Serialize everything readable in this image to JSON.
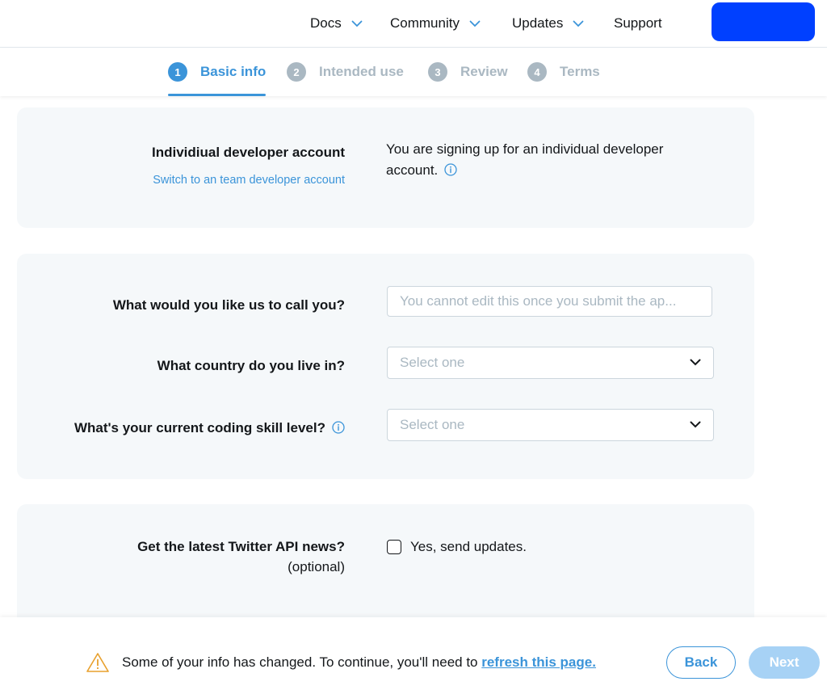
{
  "nav": {
    "items": [
      {
        "label": "Docs",
        "has_dropdown": true
      },
      {
        "label": "Community",
        "has_dropdown": true
      },
      {
        "label": "Updates",
        "has_dropdown": true
      },
      {
        "label": "Support",
        "has_dropdown": false
      }
    ],
    "cta_label": ""
  },
  "stepper": {
    "steps": [
      {
        "number": "1",
        "label": "Basic info",
        "active": true
      },
      {
        "number": "2",
        "label": "Intended use",
        "active": false
      },
      {
        "number": "3",
        "label": "Review",
        "active": false
      },
      {
        "number": "4",
        "label": "Terms",
        "active": false
      }
    ]
  },
  "account": {
    "title": "Individiual developer account",
    "switch_link": "Switch to an team developer account",
    "description": "You are signing up for an individual developer account."
  },
  "form": {
    "name_label": "What would you like us to call you?",
    "name_placeholder": "You cannot edit this once you submit the ap...",
    "country_label": "What country do you live in?",
    "country_value": "Select one",
    "skill_label": "What's your current coding skill level?",
    "skill_value": "Select one"
  },
  "news": {
    "label": "Get the latest Twitter API news?",
    "optional": "(optional)",
    "checkbox_label": "Yes, send updates."
  },
  "footer": {
    "warning_text": "Some of your info has changed. To continue, you'll need to ",
    "refresh_link": "refresh this page.",
    "back_label": "Back",
    "next_label": "Next"
  },
  "colors": {
    "accent": "#3b94d9",
    "cta": "#0040ff",
    "card_bg": "#f5f8fa",
    "next_disabled": "#a7d2f5",
    "warning": "#e8a02d"
  }
}
